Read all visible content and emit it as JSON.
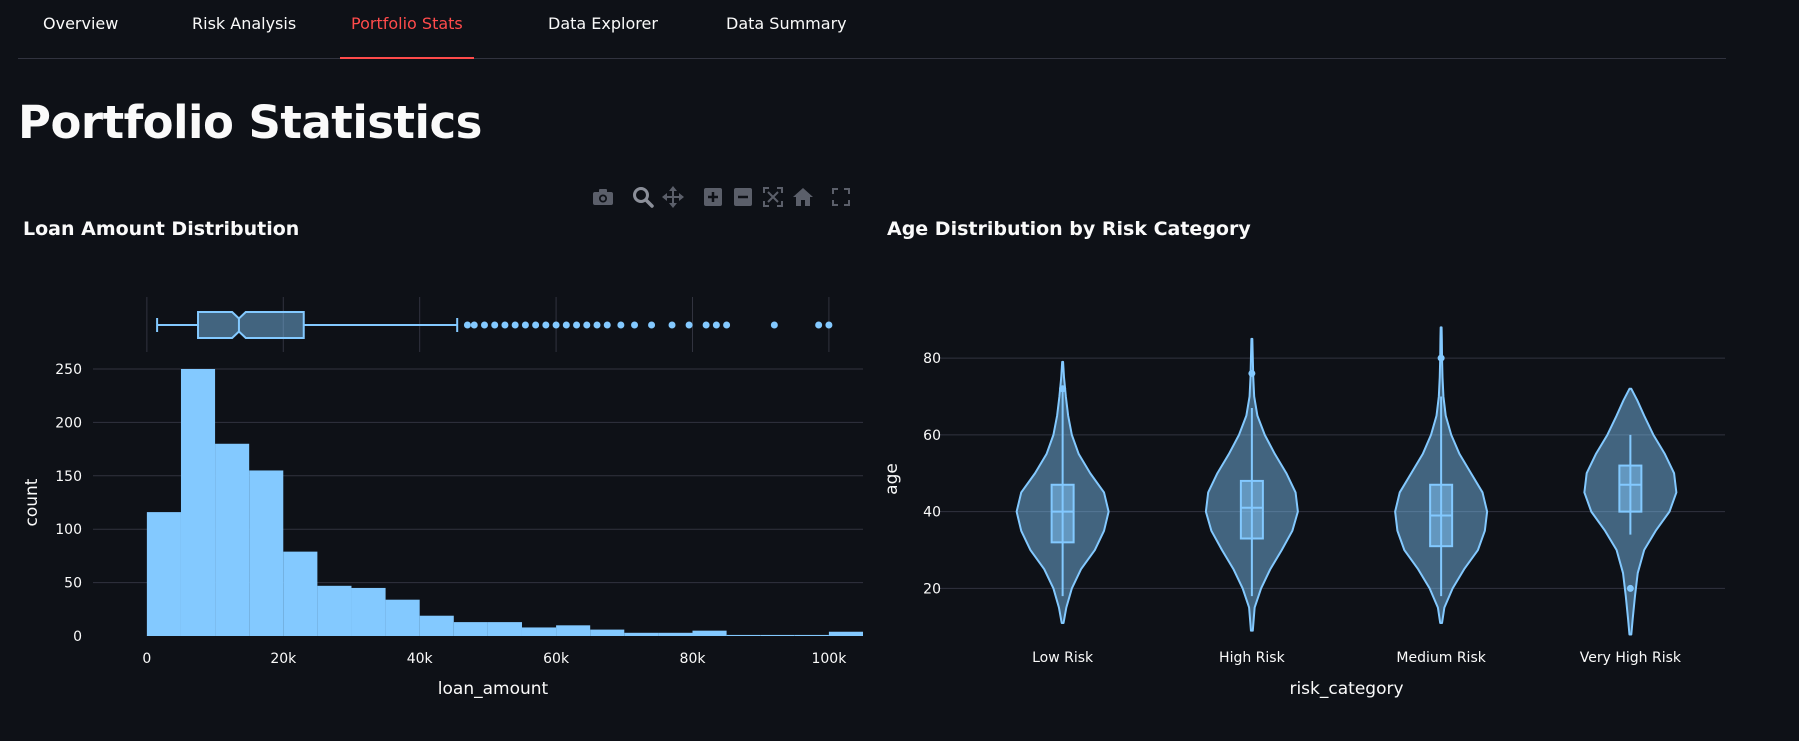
{
  "tabs": [
    {
      "label": "Overview",
      "active": false
    },
    {
      "label": "Risk Analysis",
      "active": false
    },
    {
      "label": "Portfolio Stats",
      "active": true
    },
    {
      "label": "Data Explorer",
      "active": false
    },
    {
      "label": "Data Summary",
      "active": false
    }
  ],
  "page": {
    "title": "Portfolio Statistics"
  },
  "modebar": {
    "icons": [
      "camera-icon",
      "zoom-icon",
      "pan-icon",
      "zoom-in-icon",
      "zoom-out-icon",
      "autoscale-icon",
      "reset-axes-icon",
      "fullscreen-icon"
    ]
  },
  "colors": {
    "background": "#0e1117",
    "accent": "#ff4b4b",
    "series": "#83c9ff",
    "grid": "#31333f",
    "text": "#fafafa"
  },
  "chart_data": [
    {
      "type": "bar",
      "title": "Loan Amount Distribution",
      "xlabel": "loan_amount",
      "ylabel": "count",
      "xlim": [
        -3500,
        105000
      ],
      "ylim": [
        0,
        250
      ],
      "x_ticks": [
        0,
        20000,
        40000,
        60000,
        80000,
        100000
      ],
      "x_tick_labels": [
        "0",
        "20k",
        "40k",
        "60k",
        "80k",
        "100k"
      ],
      "y_ticks": [
        0,
        50,
        100,
        150,
        200,
        250
      ],
      "y_tick_labels": [
        "0",
        "50",
        "100",
        "150",
        "200",
        "250"
      ],
      "bin_width": 5000,
      "bin_starts": [
        0,
        5000,
        10000,
        15000,
        20000,
        25000,
        30000,
        35000,
        40000,
        45000,
        50000,
        55000,
        60000,
        65000,
        70000,
        75000,
        80000,
        85000,
        90000,
        95000,
        100000
      ],
      "values": [
        116,
        250,
        180,
        155,
        79,
        47,
        45,
        34,
        19,
        13,
        13,
        8,
        10,
        6,
        3,
        3,
        5,
        1,
        1,
        1,
        4
      ],
      "marginal_box": {
        "min": 1500,
        "q1": 7500,
        "median": 13500,
        "q3": 23000,
        "upper_fence": 45500,
        "notch_low": 12500,
        "notch_high": 14500,
        "outliers": [
          47000,
          48000,
          49500,
          51000,
          52500,
          54000,
          55500,
          57000,
          58500,
          60000,
          61500,
          63000,
          64500,
          66000,
          67500,
          69500,
          71500,
          74000,
          77000,
          79500,
          82000,
          83500,
          85000,
          92000,
          98500,
          100000
        ]
      },
      "grid": true
    },
    {
      "type": "violin",
      "title": "Age Distribution by Risk Category",
      "xlabel": "risk_category",
      "ylabel": "age",
      "ylim": [
        5,
        92
      ],
      "y_ticks": [
        20,
        40,
        60,
        80
      ],
      "y_tick_labels": [
        "20",
        "40",
        "60",
        "80"
      ],
      "categories": [
        "Low Risk",
        "High Risk",
        "Medium Risk",
        "Very High Risk"
      ],
      "violins": [
        {
          "min": 11,
          "max": 79,
          "whisker_low": 18,
          "whisker_high": 72,
          "q1": 32,
          "median": 40,
          "q3": 47,
          "outliers": [
            72
          ],
          "profile": [
            [
              11,
              0.02
            ],
            [
              15,
              0.08
            ],
            [
              20,
              0.2
            ],
            [
              25,
              0.4
            ],
            [
              30,
              0.7
            ],
            [
              35,
              0.9
            ],
            [
              40,
              1.0
            ],
            [
              45,
              0.9
            ],
            [
              50,
              0.6
            ],
            [
              55,
              0.35
            ],
            [
              60,
              0.2
            ],
            [
              65,
              0.12
            ],
            [
              70,
              0.07
            ],
            [
              75,
              0.03
            ],
            [
              79,
              0.01
            ]
          ]
        },
        {
          "min": 9,
          "max": 85,
          "whisker_low": 18,
          "whisker_high": 67,
          "q1": 33,
          "median": 41,
          "q3": 48,
          "outliers": [
            76
          ],
          "profile": [
            [
              9,
              0.02
            ],
            [
              15,
              0.06
            ],
            [
              20,
              0.2
            ],
            [
              25,
              0.4
            ],
            [
              30,
              0.65
            ],
            [
              35,
              0.88
            ],
            [
              40,
              1.0
            ],
            [
              45,
              0.95
            ],
            [
              50,
              0.75
            ],
            [
              55,
              0.5
            ],
            [
              60,
              0.28
            ],
            [
              65,
              0.12
            ],
            [
              70,
              0.05
            ],
            [
              75,
              0.03
            ],
            [
              80,
              0.02
            ],
            [
              85,
              0.01
            ]
          ]
        },
        {
          "min": 11,
          "max": 88,
          "whisker_low": 18,
          "whisker_high": 70,
          "q1": 31,
          "median": 39,
          "q3": 47,
          "outliers": [
            80
          ],
          "profile": [
            [
              11,
              0.02
            ],
            [
              15,
              0.07
            ],
            [
              20,
              0.25
            ],
            [
              25,
              0.5
            ],
            [
              30,
              0.8
            ],
            [
              35,
              0.95
            ],
            [
              40,
              1.0
            ],
            [
              45,
              0.9
            ],
            [
              50,
              0.65
            ],
            [
              55,
              0.4
            ],
            [
              60,
              0.22
            ],
            [
              65,
              0.1
            ],
            [
              70,
              0.05
            ],
            [
              75,
              0.03
            ],
            [
              80,
              0.02
            ],
            [
              85,
              0.015
            ],
            [
              88,
              0.01
            ]
          ]
        },
        {
          "min": 8,
          "max": 72,
          "whisker_low": 34,
          "whisker_high": 60,
          "q1": 40,
          "median": 47,
          "q3": 52,
          "outliers": [
            20
          ],
          "profile": [
            [
              8,
              0.02
            ],
            [
              12,
              0.05
            ],
            [
              18,
              0.1
            ],
            [
              24,
              0.16
            ],
            [
              30,
              0.3
            ],
            [
              35,
              0.55
            ],
            [
              40,
              0.85
            ],
            [
              45,
              1.0
            ],
            [
              50,
              0.95
            ],
            [
              55,
              0.75
            ],
            [
              60,
              0.5
            ],
            [
              65,
              0.3
            ],
            [
              69,
              0.15
            ],
            [
              72,
              0.02
            ]
          ]
        }
      ],
      "grid": true
    }
  ]
}
